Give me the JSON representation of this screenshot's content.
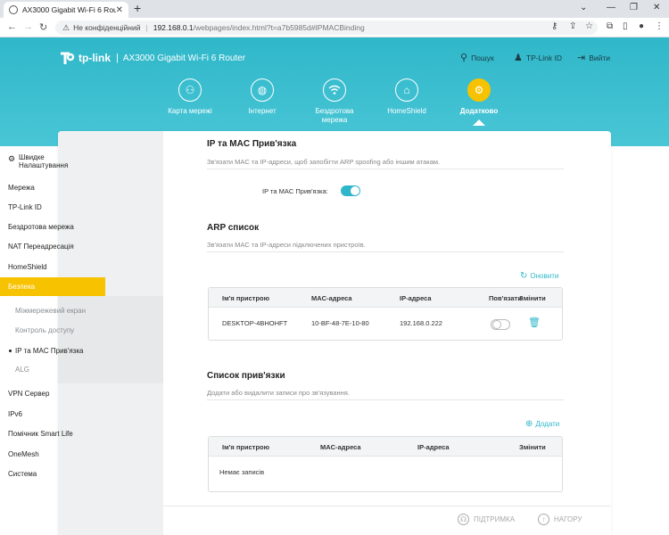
{
  "browser": {
    "tab_title": "AX3000 Gigabit Wi-Fi 6 Router",
    "security_label": "Не конфіденційний",
    "url_host": "192.168.0.1",
    "url_path": "/webpages/index.html?t=a7b5985d#IPMACBinding"
  },
  "header": {
    "logo_text": "tp-link",
    "model": "AX3000 Gigabit Wi-Fi 6 Router",
    "search_label": "Пошук",
    "tplinkid_label": "TP-Link ID",
    "logout_label": "Вийти",
    "accent_color": "#2fb7c9",
    "active_color": "#f7c200",
    "nav": [
      {
        "label": "Карта мережі",
        "icon": "network-map-icon"
      },
      {
        "label": "Інтернет",
        "icon": "globe-icon"
      },
      {
        "label": "Бездротова",
        "label2": "мережа",
        "icon": "wifi-icon"
      },
      {
        "label": "HomeShield",
        "icon": "homeshield-icon"
      },
      {
        "label": "Додатково",
        "icon": "gear-icon",
        "active": true
      }
    ]
  },
  "sidebar": {
    "quick_setup_line1": "Швидке",
    "quick_setup_line2": "Налаштування",
    "items": [
      "Мережа",
      "TP-Link ID",
      "Бездротова мережа",
      "NAT Переадресація",
      "HomeShield",
      "Безпека"
    ],
    "sub_items": [
      "Міжмережевий екран",
      "Контроль доступу",
      "IP та MAC Прив'язка",
      "ALG"
    ],
    "items_after": [
      "VPN Сервер",
      "IPv6",
      "Помічник Smart Life",
      "OneMesh",
      "Система"
    ]
  },
  "binding": {
    "title": "IP та MAC Прив'язка",
    "description": "Зв'язати MAC та IP-адреси, щоб запобігти ARP spoofing або іншим атакам.",
    "toggle_label": "IP та MAC Прив'язка:",
    "toggle_on": true
  },
  "arp": {
    "title": "ARP список",
    "description": "Зв'язати MAC та IP-адреси підключених пристроїв.",
    "refresh_label": "Оновити",
    "columns": [
      "Ім'я пристрою",
      "MAC-адреса",
      "IP-адреса",
      "Пов'язати",
      "Змінити"
    ],
    "rows": [
      {
        "device": "DESKTOP-4BHOHFT",
        "mac": "10-BF-48-7E-10-80",
        "ip": "192.168.0.222",
        "bound": false
      }
    ]
  },
  "binding_list": {
    "title": "Список прив'язки",
    "description": "Додати або видалити записи про зв'язування.",
    "add_label": "Додати",
    "columns": [
      "Ім'я пристрою",
      "MAC-адреса",
      "IP-адреса",
      "Змінити"
    ],
    "empty_text": "Немає записів"
  },
  "footer": {
    "support_label": "ПІДТРИМКА",
    "top_label": "НАГОРУ"
  }
}
